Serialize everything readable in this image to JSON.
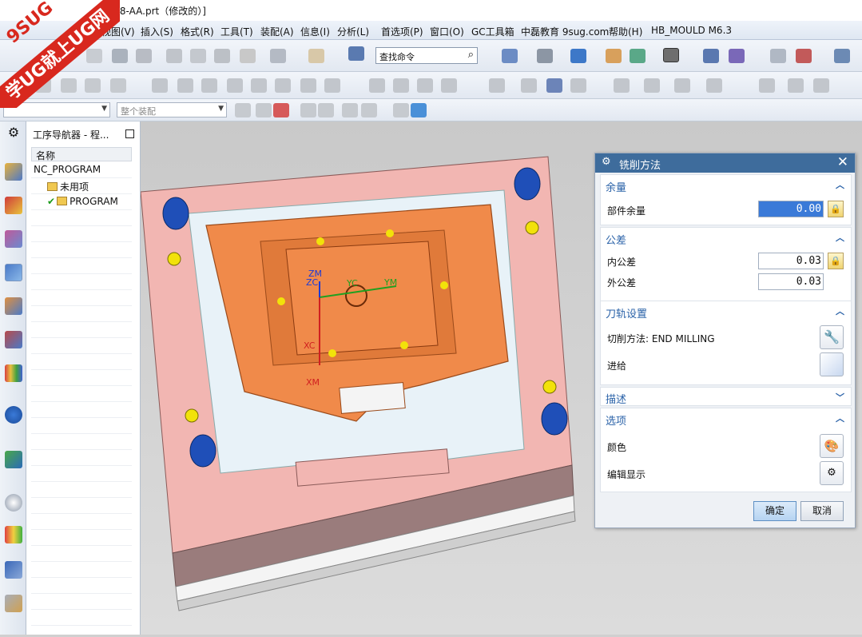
{
  "window": {
    "title": "E-8-AA.prt（修改的）]"
  },
  "watermark": {
    "brand_mark": "9SUG",
    "band_text": "学UG就上UG网"
  },
  "menu": [
    "视图(V)",
    "插入(S)",
    "格式(R)",
    "工具(T)",
    "装配(A)",
    "信息(I)",
    "分析(L)",
    "首选项(P)",
    "窗口(O)",
    "GC工具箱",
    "中磊教育 9sug.com",
    "帮助(H)",
    "HB_MOULD M6.3"
  ],
  "toolbar": {
    "search_placeholder": "查找命令",
    "filter_select": "",
    "assembly_select": "整个装配"
  },
  "navigator": {
    "title": "工序导航器 - 程...",
    "column": "名称",
    "rows": [
      {
        "label": "NC_PROGRAM"
      },
      {
        "label": "未用项"
      },
      {
        "label": "PROGRAM"
      }
    ]
  },
  "viewport_labels": {
    "zm": "ZM",
    "zc": "ZC",
    "yc": "YC",
    "ym": "YM",
    "xc": "XC",
    "xm": "XM"
  },
  "dialog": {
    "title": "铣削方法",
    "stock": {
      "header": "余量",
      "part_stock_label": "部件余量",
      "part_stock_value": "0.00"
    },
    "tolerance": {
      "header": "公差",
      "intol_label": "内公差",
      "intol_value": "0.03",
      "outtol_label": "外公差",
      "outtol_value": "0.03"
    },
    "path_settings": {
      "header": "刀轨设置",
      "cut_method_label": "切削方法: END MILLING",
      "feed_label": "进给"
    },
    "description": {
      "header": "描述"
    },
    "options": {
      "header": "选项",
      "color_label": "颜色",
      "edit_display_label": "编辑显示"
    },
    "ok": "确定",
    "cancel": "取消"
  },
  "colors": {
    "dialog_title": "#3e6c9c",
    "section_header": "#2a62a8",
    "plate": "#f2b6b2",
    "core": "#f08a4a",
    "pin": "#1f4fb8"
  }
}
